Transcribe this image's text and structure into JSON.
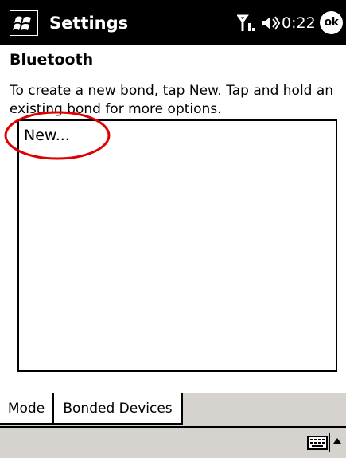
{
  "titlebar": {
    "app_title": "Settings",
    "clock": "0:22",
    "ok_label": "ok"
  },
  "page": {
    "title": "Bluetooth",
    "instructions": "To create a new bond, tap New. Tap and hold an existing bond for more options."
  },
  "bond_list": {
    "items": [
      {
        "label": "New..."
      }
    ]
  },
  "annotation": {
    "highlight_color": "#e00000"
  },
  "tabs": [
    {
      "label": "Mode",
      "selected": false
    },
    {
      "label": "Bonded Devices",
      "selected": true
    }
  ],
  "icons": {
    "start": "windows-start-icon",
    "signal": "signal-antenna-icon",
    "volume": "speaker-volume-icon",
    "keyboard": "keyboard-icon",
    "sip": "input-panel-arrow-icon"
  }
}
